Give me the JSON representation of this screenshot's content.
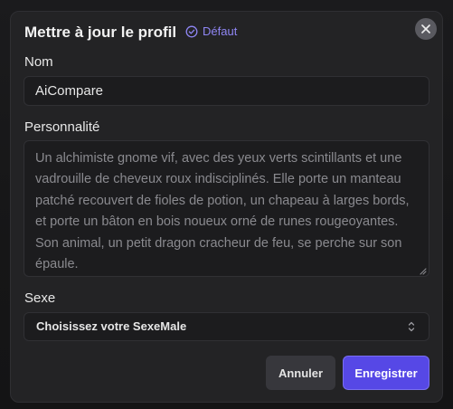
{
  "modal": {
    "title": "Mettre à jour le profil",
    "badge_label": "Défaut",
    "close_icon": "close-icon"
  },
  "form": {
    "name_label": "Nom",
    "name_value": "AiCompare",
    "personality_label": "Personnalité",
    "personality_placeholder": "Un alchimiste gnome vif, avec des yeux verts scintillants et une vadrouille de cheveux roux indisciplinés. Elle porte un manteau patché recouvert de fioles de potion, un chapeau à larges bords, et porte un bâton en bois noueux orné de runes rougeoyantes. Son animal, un petit dragon cracheur de feu, se perche sur son épaule.",
    "gender_label": "Sexe",
    "gender_selected": "Choisissez votre SexeMale"
  },
  "actions": {
    "cancel_label": "Annuler",
    "save_label": "Enregistrer"
  },
  "colors": {
    "accent": "#5648e6",
    "badge": "#8f86f4",
    "background": "#161617",
    "panel": "#232325"
  }
}
